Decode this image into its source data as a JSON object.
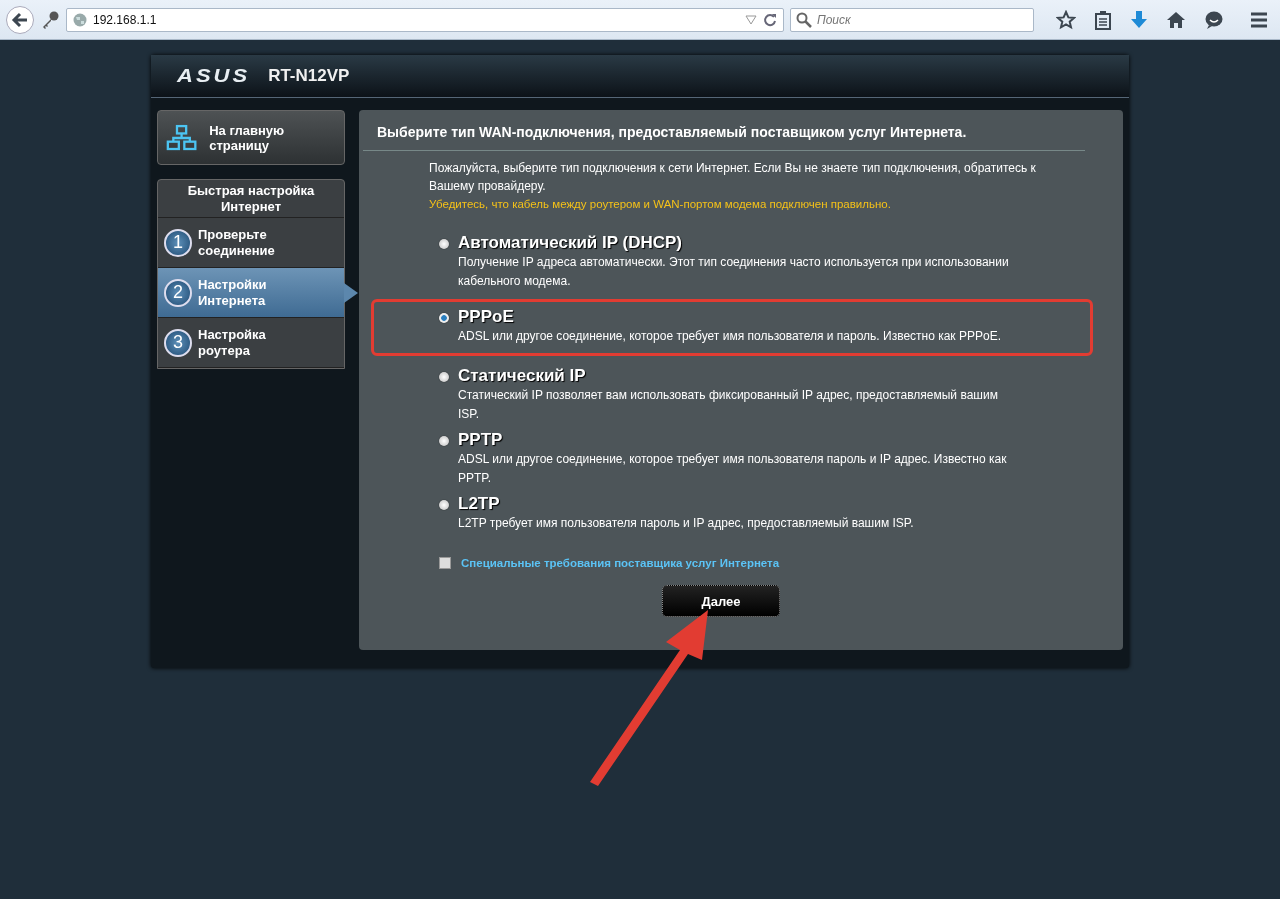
{
  "browser": {
    "url": "192.168.1.1",
    "search": {
      "placeholder": "Поиск"
    }
  },
  "router": {
    "brand": "ASUS",
    "model": "RT-N12VP"
  },
  "sidebar": {
    "home": "На главную страницу",
    "section_title": "Быстрая настройка Интернет",
    "steps": [
      {
        "number": "1",
        "label": "Проверьте соединение",
        "selected": false
      },
      {
        "number": "2",
        "label": "Настройки Интернета",
        "selected": true
      },
      {
        "number": "3",
        "label": "Настройка роутера",
        "selected": false
      }
    ]
  },
  "panel": {
    "title": "Выберите тип WAN-подключения, предоставляемый поставщиком услуг Интернета.",
    "intro": "Пожалуйста, выберите тип подключения к сети Интернет. Если Вы не знаете тип подключения, обратитесь к Вашему провайдеру.",
    "warning": "Убедитесь, что кабель между роутером и WAN-портом модема подключен правильно.",
    "options": [
      {
        "label": "Автоматический IP (DHCP)",
        "description": "Получение IP адреса автоматически. Этот тип соединения часто используется при использовании кабельного модема.",
        "selected": false,
        "highlighted": false
      },
      {
        "label": "PPPoE",
        "description": "ADSL или другое соединение, которое требует имя пользователя и пароль. Известно как PPPoE.",
        "selected": true,
        "highlighted": true
      },
      {
        "label": "Статический IP",
        "description": "Статический IP позволяет вам использовать фиксированный IP адрес, предоставляемый вашим ISP.",
        "selected": false,
        "highlighted": false
      },
      {
        "label": "PPTP",
        "description": "ADSL или другое соединение, которое требует имя пользователя пароль и IP адрес. Известно как PPTP.",
        "selected": false,
        "highlighted": false
      },
      {
        "label": "L2TP",
        "description": "L2TP требует имя пользователя пароль и IP адрес, предоставляемый вашим ISP.",
        "selected": false,
        "highlighted": false
      }
    ],
    "special": {
      "label": "Специальные требования поставщика услуг Интернета",
      "checked": false
    },
    "next_button": "Далее"
  }
}
